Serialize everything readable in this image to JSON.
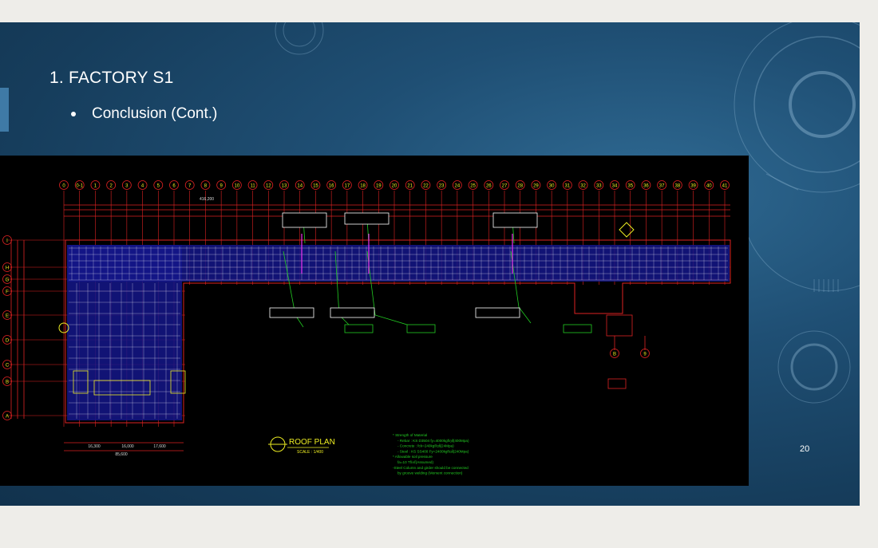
{
  "slide": {
    "title": "1. FACTORY S1",
    "bullet": "Conclusion (Cont.)",
    "page_number": "20"
  },
  "drawing": {
    "plan_title": "ROOF PLAN",
    "plan_scale": "SCALE : 1/400",
    "column_labels": [
      "0",
      "0-1",
      "1",
      "2",
      "3",
      "4",
      "5",
      "6",
      "7",
      "8",
      "9",
      "10",
      "11",
      "12",
      "13",
      "14",
      "15",
      "16",
      "17",
      "18",
      "19",
      "20",
      "21",
      "22",
      "23",
      "24",
      "25",
      "26",
      "27",
      "28",
      "29",
      "30",
      "31",
      "32",
      "33",
      "34",
      "35",
      "36",
      "37",
      "38",
      "39",
      "40",
      "41"
    ],
    "row_labels": [
      "I",
      "H",
      "G",
      "F",
      "E",
      "D",
      "C",
      "B",
      "A"
    ],
    "bottom_grid_labels": [
      "B",
      "9"
    ],
    "bottom_dims": [
      "16,300",
      "16,000",
      "17,600",
      "85,600"
    ],
    "top_dim_total": "416,200",
    "notes": [
      "* Strength of Material",
      "- Rebar : KS D3504 fy=4000kgf/㎠(400Mpa)",
      "- Concrete : fck=240kgf/㎠(24Mpa)",
      "- Steel : KS SS400 Fy=2400kgf/㎠(240Mpa)",
      "* Allowable soil pressure",
      "fa=10 Tf/㎡(Assumed)",
      "-Steel Column and girder should be connected",
      "by groove welding (Moment connection)"
    ]
  }
}
